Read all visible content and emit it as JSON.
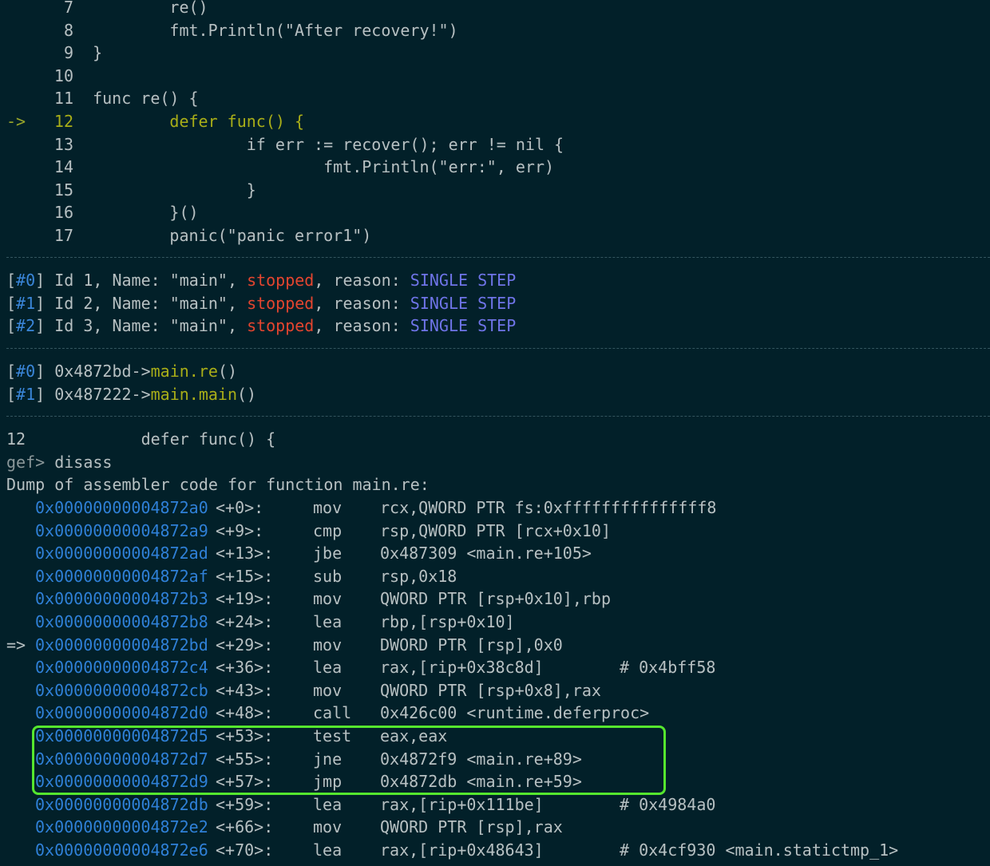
{
  "source_lines": [
    {
      "n": "7",
      "code": "        re()"
    },
    {
      "n": "8",
      "code": "        fmt.Println(\"After recovery!\")"
    },
    {
      "n": "9",
      "code": "}"
    },
    {
      "n": "10",
      "code": ""
    },
    {
      "n": "11",
      "code": "func re() {"
    },
    {
      "n": "12",
      "code": "        defer func() {"
    },
    {
      "n": "13",
      "code": "                if err := recover(); err != nil {"
    },
    {
      "n": "14",
      "code": "                        fmt.Println(\"err:\", err)"
    },
    {
      "n": "15",
      "code": "                }"
    },
    {
      "n": "16",
      "code": "        }()"
    },
    {
      "n": "17",
      "code": "        panic(\"panic error1\")"
    }
  ],
  "current_marker": "->",
  "threads": [
    {
      "idx": "#0",
      "pre": " Id 1, Name: \"main\", ",
      "state": "stopped",
      "mid": ", reason: ",
      "reason": "SINGLE STEP"
    },
    {
      "idx": "#1",
      "pre": " Id 2, Name: \"main\", ",
      "state": "stopped",
      "mid": ", reason: ",
      "reason": "SINGLE STEP"
    },
    {
      "idx": "#2",
      "pre": " Id 3, Name: \"main\", ",
      "state": "stopped",
      "mid": ", reason: ",
      "reason": "SINGLE STEP"
    }
  ],
  "frames": [
    {
      "idx": "#0",
      "addr": " 0x4872bd->",
      "fn": "main.re",
      "tail": "()"
    },
    {
      "idx": "#1",
      "addr": " 0x487222->",
      "fn": "main.main",
      "tail": "()"
    }
  ],
  "context_line": {
    "n": "12",
    "code": "            defer func() {"
  },
  "prompt": {
    "label": "gef>",
    "command": " disass"
  },
  "dump_header": "Dump of assembler code for function main.re:",
  "asm": [
    {
      "addr": "0x00000000004872a0",
      "off": "<+0>:",
      "op": "mov",
      "args": "rcx,QWORD PTR fs:0xfffffffffffffff8",
      "cmt": ""
    },
    {
      "addr": "0x00000000004872a9",
      "off": "<+9>:",
      "op": "cmp",
      "args": "rsp,QWORD PTR [rcx+0x10]",
      "cmt": ""
    },
    {
      "addr": "0x00000000004872ad",
      "off": "<+13>:",
      "op": "jbe",
      "args": "0x487309 <main.re+105>",
      "cmt": ""
    },
    {
      "addr": "0x00000000004872af",
      "off": "<+15>:",
      "op": "sub",
      "args": "rsp,0x18",
      "cmt": ""
    },
    {
      "addr": "0x00000000004872b3",
      "off": "<+19>:",
      "op": "mov",
      "args": "QWORD PTR [rsp+0x10],rbp",
      "cmt": ""
    },
    {
      "addr": "0x00000000004872b8",
      "off": "<+24>:",
      "op": "lea",
      "args": "rbp,[rsp+0x10]",
      "cmt": ""
    },
    {
      "addr": "0x00000000004872bd",
      "off": "<+29>:",
      "op": "mov",
      "args": "DWORD PTR [rsp],0x0",
      "cmt": "",
      "marker": "=>"
    },
    {
      "addr": "0x00000000004872c4",
      "off": "<+36>:",
      "op": "lea",
      "args": "rax,[rip+0x38c8d]",
      "cmt": "# 0x4bff58"
    },
    {
      "addr": "0x00000000004872cb",
      "off": "<+43>:",
      "op": "mov",
      "args": "QWORD PTR [rsp+0x8],rax",
      "cmt": ""
    },
    {
      "addr": "0x00000000004872d0",
      "off": "<+48>:",
      "op": "call",
      "args": "0x426c00 <runtime.deferproc>",
      "cmt": ""
    },
    {
      "addr": "0x00000000004872d5",
      "off": "<+53>:",
      "op": "test",
      "args": "eax,eax",
      "cmt": ""
    },
    {
      "addr": "0x00000000004872d7",
      "off": "<+55>:",
      "op": "jne",
      "args": "0x4872f9 <main.re+89>",
      "cmt": ""
    },
    {
      "addr": "0x00000000004872d9",
      "off": "<+57>:",
      "op": "jmp",
      "args": "0x4872db <main.re+59>",
      "cmt": ""
    },
    {
      "addr": "0x00000000004872db",
      "off": "<+59>:",
      "op": "lea",
      "args": "rax,[rip+0x111be]",
      "cmt": "# 0x4984a0"
    },
    {
      "addr": "0x00000000004872e2",
      "off": "<+66>:",
      "op": "mov",
      "args": "QWORD PTR [rsp],rax",
      "cmt": ""
    },
    {
      "addr": "0x00000000004872e6",
      "off": "<+70>:",
      "op": "lea",
      "args": "rax,[rip+0x48643]",
      "cmt": "# 0x4cf930 <main.statictmp_1>"
    }
  ],
  "colors": {
    "bg": "#022029",
    "highlight_box": "#55e62e",
    "address": "#2f80d7",
    "stopped": "#e5452f",
    "reason": "#6f74e8"
  }
}
